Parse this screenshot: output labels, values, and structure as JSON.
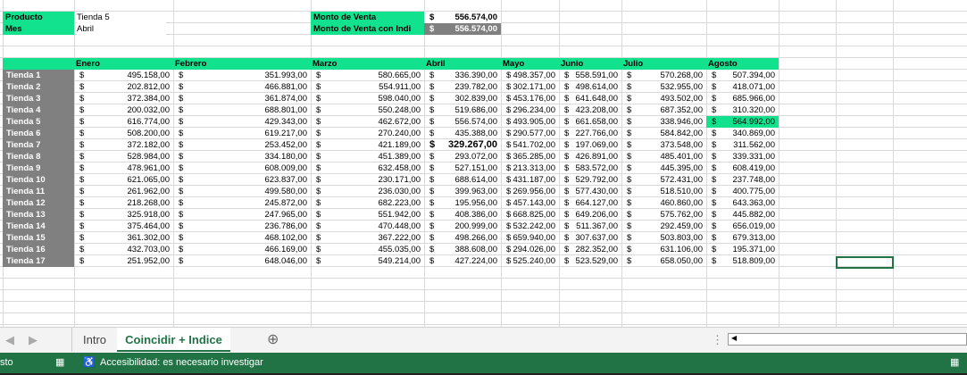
{
  "lookup": {
    "producto_label": "Producto",
    "producto_value": "Tienda 5",
    "mes_label": "Mes",
    "mes_value": "Abril",
    "monto_label": "Monto de Venta",
    "monto_currency": "$",
    "monto_value": "556.574,00",
    "monto_indice_label": "Monto de Venta con Indi",
    "monto_indice_currency": "$",
    "monto_indice_value": "556.574,00"
  },
  "table": {
    "currency": "$",
    "months": [
      "Enero",
      "Febrero",
      "Marzo",
      "Abril",
      "Mayo",
      "Junio",
      "Julio",
      "Agosto"
    ],
    "rows": [
      [
        "Tienda 1",
        "495.158,00",
        "351.993,00",
        "580.665,00",
        "336.390,00",
        "498.357,00",
        "558.591,00",
        "570.268,00",
        "507.394,00"
      ],
      [
        "Tienda 2",
        "202.812,00",
        "466.881,00",
        "554.911,00",
        "239.782,00",
        "302.171,00",
        "498.614,00",
        "532.955,00",
        "418.071,00"
      ],
      [
        "Tienda 3",
        "372.384,00",
        "361.874,00",
        "598.040,00",
        "302.839,00",
        "453.176,00",
        "641.648,00",
        "493.502,00",
        "685.966,00"
      ],
      [
        "Tienda 4",
        "200.032,00",
        "688.801,00",
        "550.248,00",
        "519.686,00",
        "296.234,00",
        "423.208,00",
        "687.352,00",
        "310.320,00"
      ],
      [
        "Tienda 5",
        "616.774,00",
        "429.343,00",
        "462.672,00",
        "556.574,00",
        "493.905,00",
        "661.658,00",
        "338.946,00",
        "564.992,00"
      ],
      [
        "Tienda 6",
        "508.200,00",
        "619.217,00",
        "270.240,00",
        "435.388,00",
        "290.577,00",
        "227.766,00",
        "584.842,00",
        "340.869,00"
      ],
      [
        "Tienda 7",
        "372.182,00",
        "253.452,00",
        "421.189,00",
        "329.267,00",
        "541.702,00",
        "197.069,00",
        "373.548,00",
        "311.562,00"
      ],
      [
        "Tienda 8",
        "528.984,00",
        "334.180,00",
        "451.389,00",
        "293.072,00",
        "365.285,00",
        "426.891,00",
        "485.401,00",
        "339.331,00"
      ],
      [
        "Tienda 9",
        "478.961,00",
        "608.009,00",
        "632.458,00",
        "527.151,00",
        "213.313,00",
        "583.572,00",
        "445.395,00",
        "608.419,00"
      ],
      [
        "Tienda 10",
        "621.065,00",
        "623.837,00",
        "230.171,00",
        "688.614,00",
        "431.187,00",
        "529.792,00",
        "572.431,00",
        "237.748,00"
      ],
      [
        "Tienda 11",
        "261.962,00",
        "499.580,00",
        "236.030,00",
        "399.963,00",
        "269.956,00",
        "577.430,00",
        "518.510,00",
        "400.775,00"
      ],
      [
        "Tienda 12",
        "218.268,00",
        "245.872,00",
        "682.223,00",
        "195.956,00",
        "457.143,00",
        "664.127,00",
        "460.860,00",
        "643.363,00"
      ],
      [
        "Tienda 13",
        "325.918,00",
        "247.965,00",
        "551.942,00",
        "408.386,00",
        "668.825,00",
        "649.206,00",
        "575.762,00",
        "445.882,00"
      ],
      [
        "Tienda 14",
        "375.464,00",
        "236.786,00",
        "470.448,00",
        "200.999,00",
        "532.242,00",
        "511.367,00",
        "292.459,00",
        "656.019,00"
      ],
      [
        "Tienda 15",
        "361.302,00",
        "468.102,00",
        "367.222,00",
        "498.266,00",
        "659.940,00",
        "307.637,00",
        "503.803,00",
        "679.313,00"
      ],
      [
        "Tienda 16",
        "432.703,00",
        "466.169,00",
        "455.035,00",
        "388.608,00",
        "294.026,00",
        "282.352,00",
        "631.106,00",
        "195.371,00"
      ],
      [
        "Tienda 17",
        "251.952,00",
        "648.046,00",
        "549.214,00",
        "427.224,00",
        "525.240,00",
        "523.529,00",
        "658.050,00",
        "518.809,00"
      ]
    ]
  },
  "sheet_tabs": [
    "Intro",
    "Coincidir + Indice"
  ],
  "status": {
    "mode": "sto",
    "accessibility": "Accesibilidad: es necesario investigar"
  },
  "colors": {
    "accent": "#12e28e",
    "excel_green": "#217346",
    "gray": "#808080"
  }
}
